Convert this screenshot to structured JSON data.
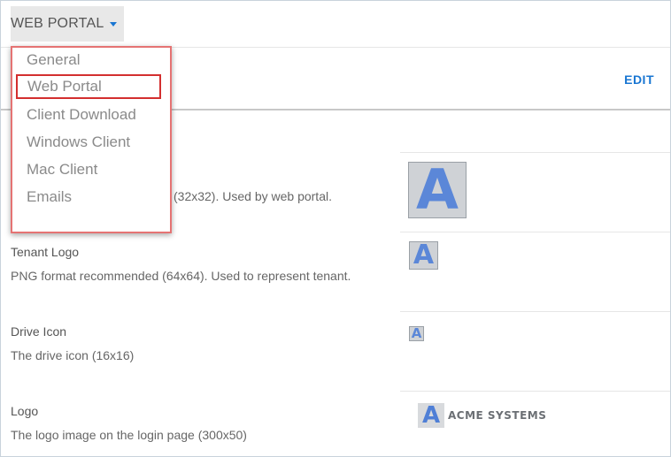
{
  "portal_selector": {
    "label": "WEB PORTAL"
  },
  "header": {
    "edit_label": "EDIT"
  },
  "menu": {
    "items": [
      "General",
      "Web Portal",
      "Client Download",
      "Windows Client",
      "Mac Client",
      "Emails"
    ],
    "selected": "Web Portal"
  },
  "settings": [
    {
      "title": "",
      "description_tail": "(32x32). Used by web portal.",
      "preview_letter": "A"
    },
    {
      "title": "Tenant Logo",
      "description": "PNG format recommended (64x64). Used to represent tenant.",
      "preview_letter": "A"
    },
    {
      "title": "Drive Icon",
      "description": "The drive icon (16x16)",
      "preview_letter": "A"
    },
    {
      "title": "Logo",
      "description": "The logo image on the login page (300x50)",
      "preview_letter": "A",
      "preview_text": "ACME SYSTEMS"
    }
  ],
  "colors": {
    "accent": "#1976d2",
    "menu_border": "#e57373",
    "selected_outline": "#d32f2f",
    "logo_blue": "#5b87d8"
  }
}
